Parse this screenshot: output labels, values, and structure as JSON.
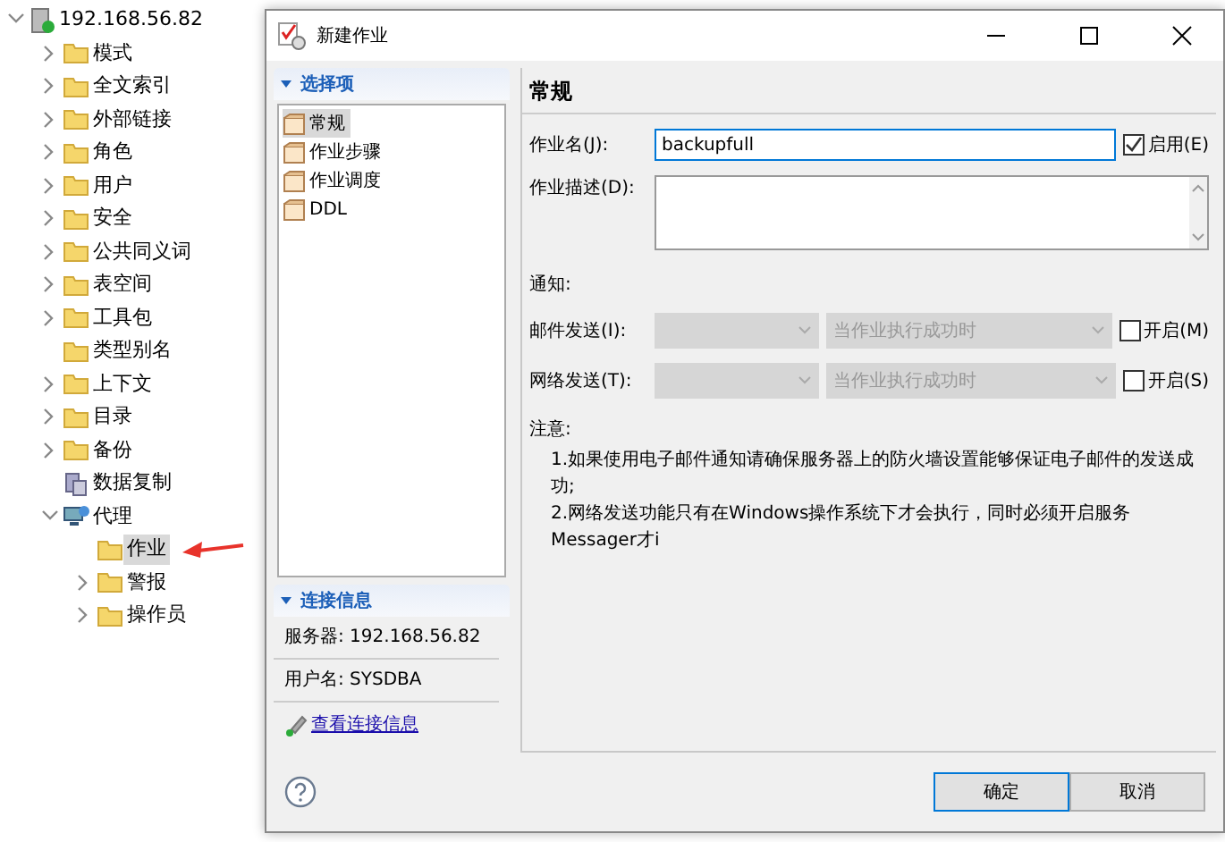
{
  "tree": {
    "label": "192.168.56.82",
    "kind": "server",
    "expanded": true,
    "selected": false,
    "children": [
      {
        "label": "模式",
        "kind": "folder",
        "expanded": false,
        "selected": false
      },
      {
        "label": "全文索引",
        "kind": "folder",
        "expanded": false,
        "selected": false
      },
      {
        "label": "外部链接",
        "kind": "folder",
        "expanded": false,
        "selected": false
      },
      {
        "label": "角色",
        "kind": "folder",
        "expanded": false,
        "selected": false
      },
      {
        "label": "用户",
        "kind": "folder",
        "expanded": false,
        "selected": false
      },
      {
        "label": "安全",
        "kind": "folder",
        "expanded": false,
        "selected": false
      },
      {
        "label": "公共同义词",
        "kind": "folder",
        "expanded": false,
        "selected": false
      },
      {
        "label": "表空间",
        "kind": "folder",
        "expanded": false,
        "selected": false
      },
      {
        "label": "工具包",
        "kind": "folder",
        "expanded": false,
        "selected": false
      },
      {
        "label": "类型别名",
        "kind": "folder",
        "selected": false
      },
      {
        "label": "上下文",
        "kind": "folder",
        "expanded": false,
        "selected": false
      },
      {
        "label": "目录",
        "kind": "folder",
        "expanded": false,
        "selected": false
      },
      {
        "label": "备份",
        "kind": "folder",
        "expanded": false,
        "selected": false
      },
      {
        "label": "数据复制",
        "kind": "replication",
        "selected": false
      },
      {
        "label": "代理",
        "kind": "agent",
        "expanded": true,
        "selected": false,
        "children": [
          {
            "label": "作业",
            "kind": "folder",
            "selected": true
          },
          {
            "label": "警报",
            "kind": "folder",
            "expanded": false,
            "selected": false
          },
          {
            "label": "操作员",
            "kind": "folder",
            "expanded": false,
            "selected": false
          }
        ]
      }
    ]
  },
  "dialog": {
    "title": "新建作业",
    "nav_section": {
      "title": "选择项",
      "expanded": true,
      "items": [
        {
          "label": "常规",
          "selected": true
        },
        {
          "label": "作业步骤",
          "selected": false
        },
        {
          "label": "作业调度",
          "selected": false
        },
        {
          "label": "DDL",
          "selected": false
        }
      ]
    },
    "connection_section": {
      "title": "连接信息",
      "expanded": true,
      "lines": [
        "服务器: 192.168.56.82",
        "用户名: SYSDBA"
      ],
      "link": "查看连接信息"
    },
    "page_title": "常规",
    "job_name": {
      "label": "作业名(J):",
      "value": "backupfull"
    },
    "enabled": {
      "label": "启用(E)",
      "checked": true
    },
    "description": {
      "label": "作业描述(D):"
    },
    "notify_label": "通知:",
    "notify_rows": [
      {
        "label": "邮件发送(I):",
        "condition": "当作业执行成功时",
        "toggle": {
          "label": "开启(M)",
          "checked": false
        }
      },
      {
        "label": "网络发送(T):",
        "condition": "当作业执行成功时",
        "toggle": {
          "label": "开启(S)",
          "checked": false
        }
      }
    ],
    "notes_title": "注意:",
    "notes": [
      "1.如果使用电子邮件通知请确保服务器上的防火墙设置能够保证电子邮件的发送成功;",
      "2.网络发送功能只有在Windows操作系统下才会执行，同时必须开启服务Messager才i"
    ],
    "buttons": [
      {
        "label": "确定",
        "default": true
      },
      {
        "label": "取消",
        "default": false
      }
    ]
  }
}
